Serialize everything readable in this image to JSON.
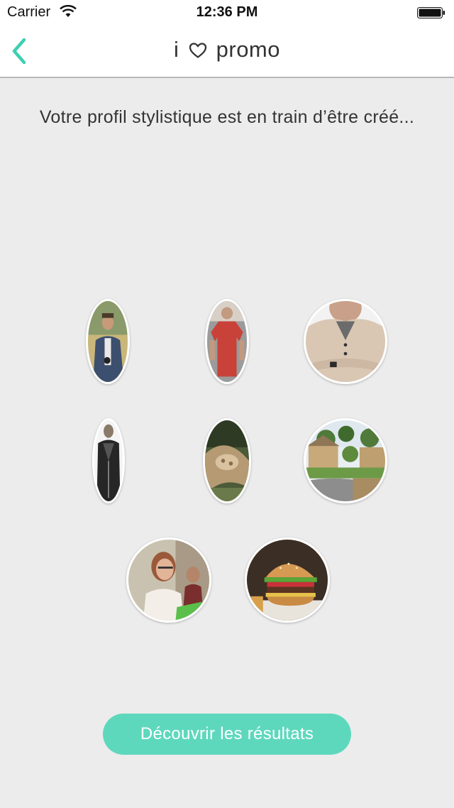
{
  "status_bar": {
    "carrier": "Carrier",
    "time": "12:36 PM",
    "wifi_icon": "wifi-icon",
    "battery_icon": "battery-icon"
  },
  "nav": {
    "back_icon": "chevron-left-icon",
    "title_prefix": "i",
    "title_icon": "heart-outline-icon",
    "title_suffix": "promo",
    "accent_color": "#3ecfb1"
  },
  "message": "Votre profil stylistique est en train d’être créé...",
  "thumbnails": [
    {
      "id": "man-with-phone",
      "label": "man with phone photo"
    },
    {
      "id": "red-tshirt",
      "label": "red t-shirt photo"
    },
    {
      "id": "knit-sweater",
      "label": "knit sweater photo"
    },
    {
      "id": "leather-jacket",
      "label": "leather jacket photo"
    },
    {
      "id": "food-closeup",
      "label": "food close-up photo"
    },
    {
      "id": "village-street",
      "label": "village street photo"
    },
    {
      "id": "woman-smiling",
      "label": "smiling woman photo"
    },
    {
      "id": "burger",
      "label": "burger photo"
    }
  ],
  "cta": {
    "label": "Découvrir les résultats",
    "color": "#5ed8bd"
  }
}
